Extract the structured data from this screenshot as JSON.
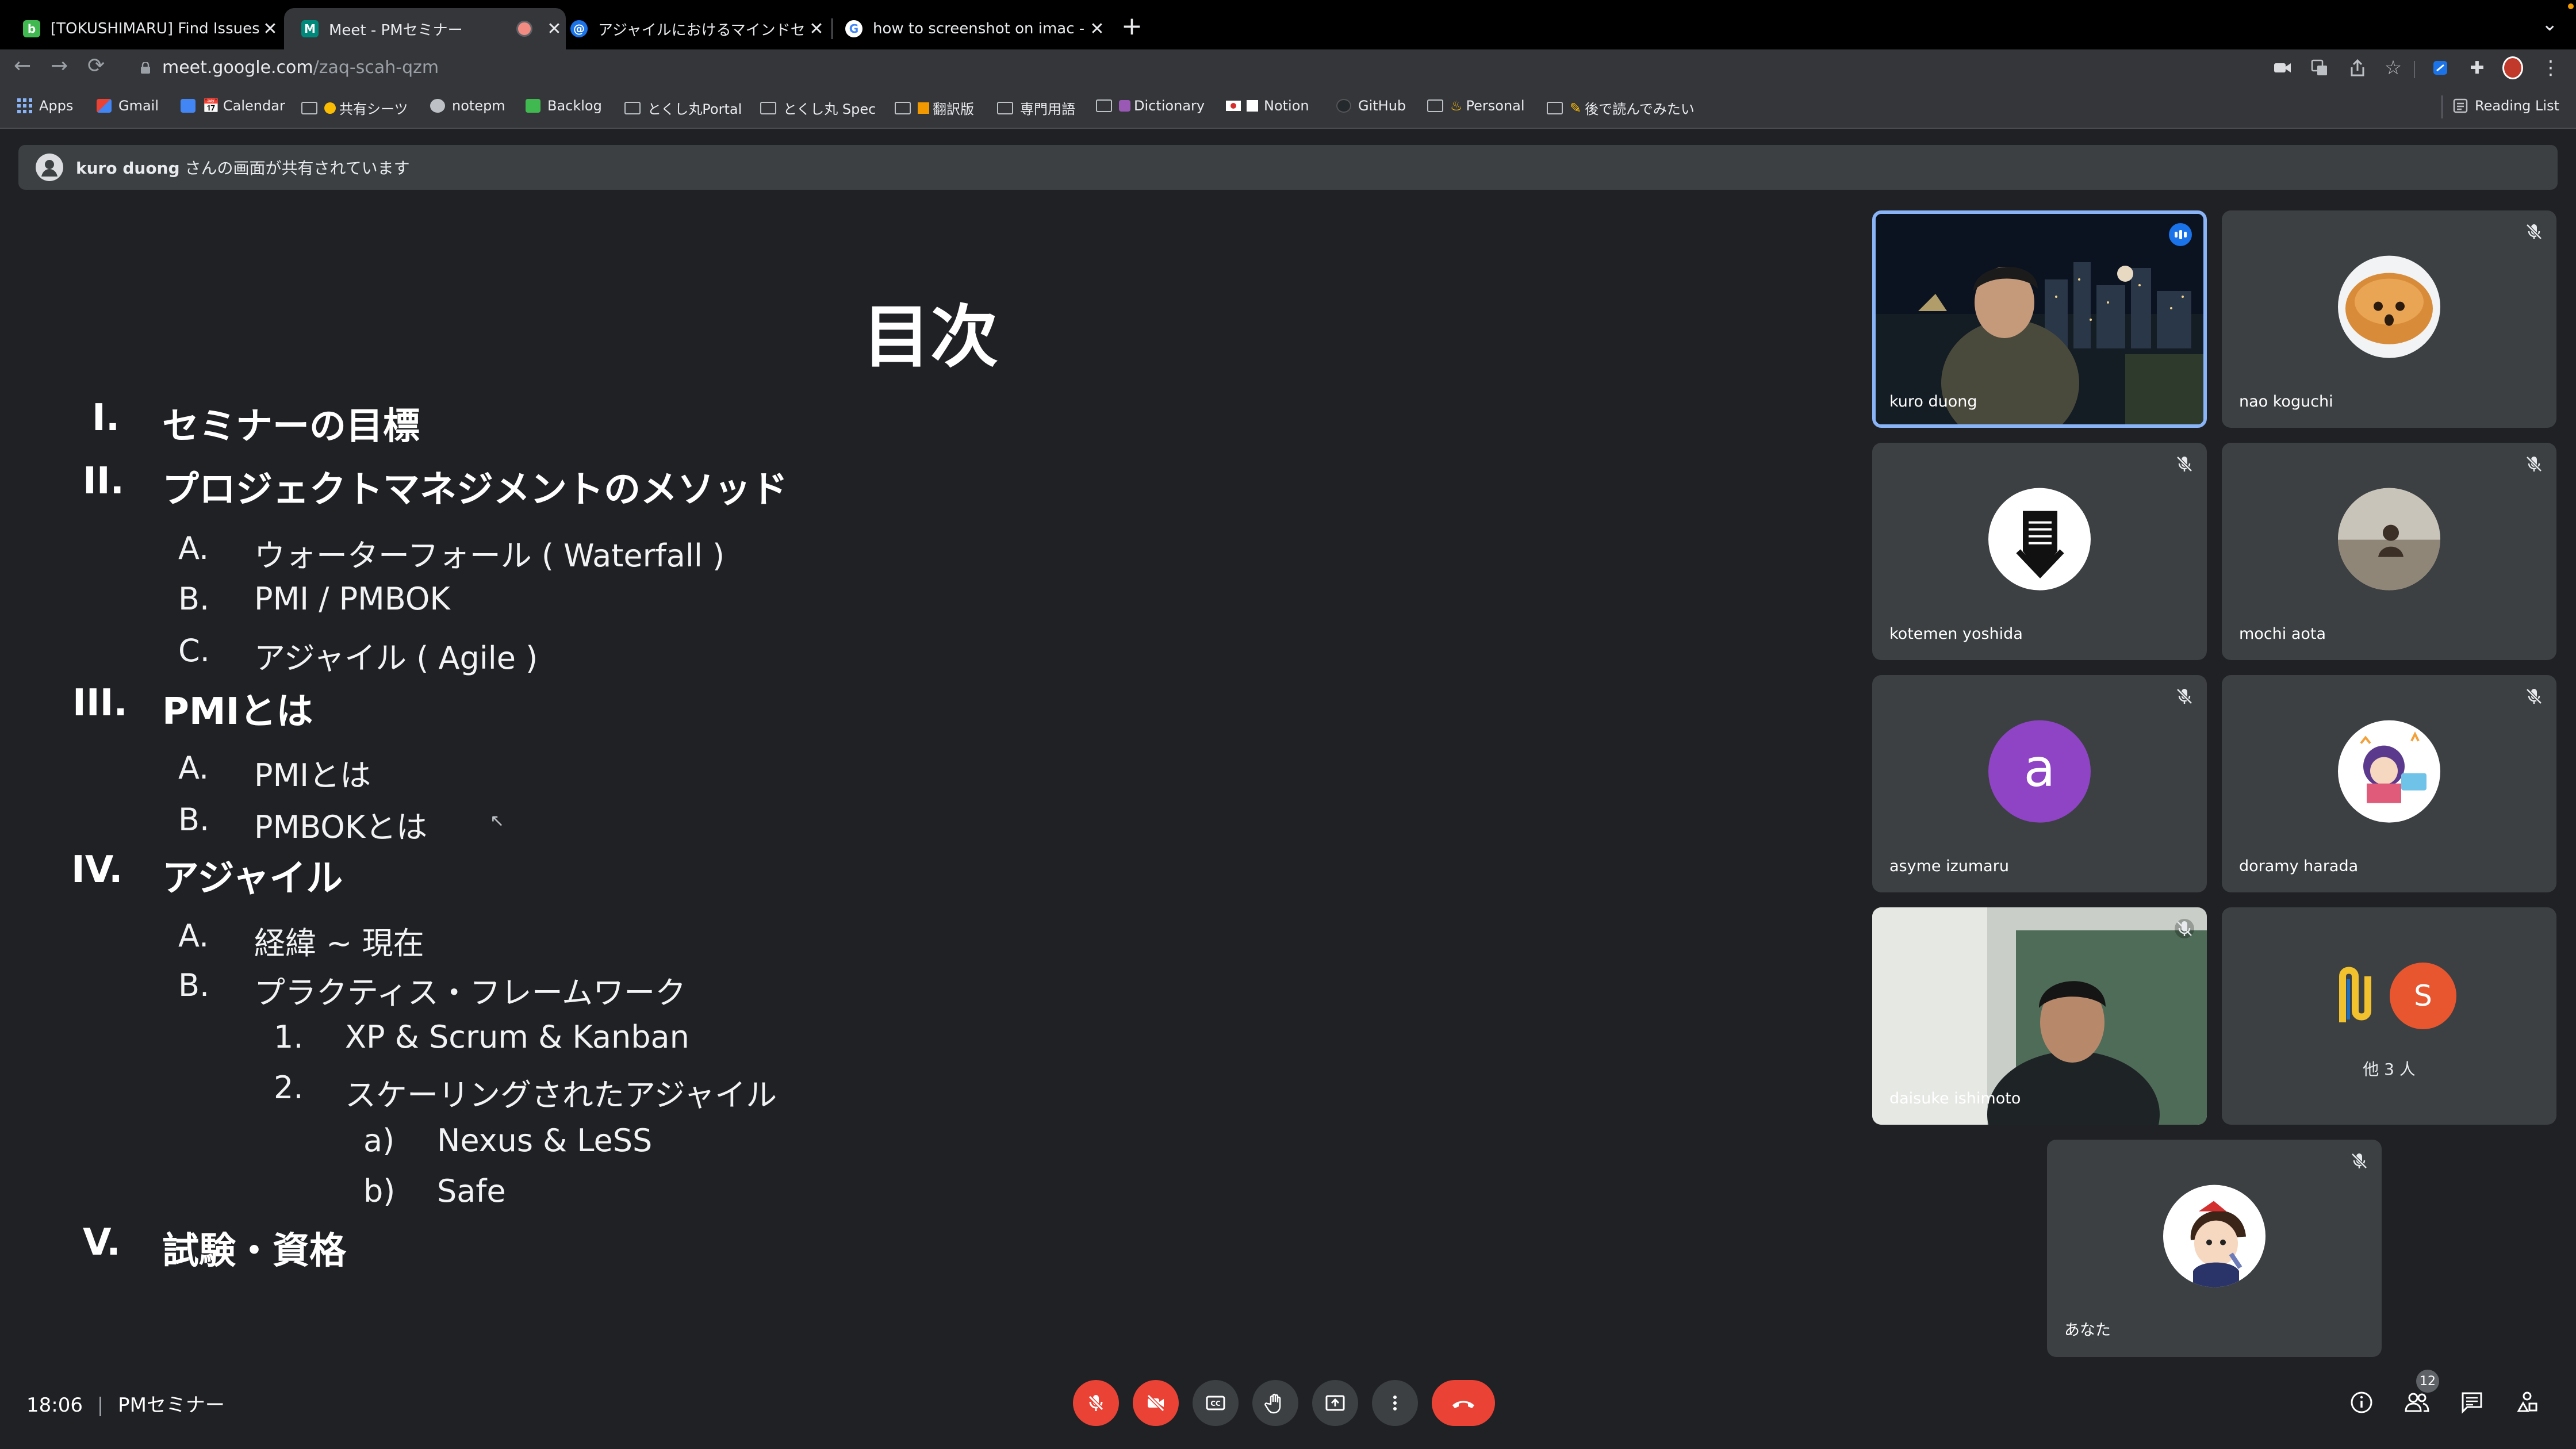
{
  "tabs": [
    {
      "title": "[TOKUSHIMARU] Find Issues |",
      "favicon_color": "#3fb950",
      "favicon_letter": "b"
    },
    {
      "title": "Meet - PMセミナー",
      "favicon_color": "#00897b",
      "favicon_letter": "M",
      "active": true
    },
    {
      "title": "アジャイルにおけるマインドセッ",
      "favicon_color": "#1a73e8",
      "favicon_letter": "@"
    },
    {
      "title": "how to screenshot on imac - G",
      "favicon_color": "#ffffff",
      "favicon_letter": "G"
    }
  ],
  "address": {
    "host": "meet.google.com",
    "path": "/zaq-scah-qzm"
  },
  "bookmarks": [
    {
      "label": "Apps",
      "type": "apps"
    },
    {
      "label": "Gmail",
      "type": "gmail"
    },
    {
      "label": "Calendar",
      "type": "calendar"
    },
    {
      "label": "共有シーツ",
      "type": "folder",
      "emoji": "🟡"
    },
    {
      "label": "notepm",
      "type": "site"
    },
    {
      "label": "Backlog",
      "type": "backlog"
    },
    {
      "label": "とくし丸Portal",
      "type": "folder"
    },
    {
      "label": "とくし丸 Spec",
      "type": "folder"
    },
    {
      "label": "翻訳版",
      "type": "folder",
      "emoji": "🟧"
    },
    {
      "label": "専門用語",
      "type": "folder"
    },
    {
      "label": "Dictionary",
      "type": "folder"
    },
    {
      "label": "Notion",
      "type": "notion"
    },
    {
      "label": "GitHub",
      "type": "github"
    },
    {
      "label": "Personal",
      "type": "folder"
    },
    {
      "label": "後で読んでみたい",
      "type": "folder"
    }
  ],
  "reading_list": "Reading List",
  "banner": {
    "presenter": "kuro duong",
    "suffix": " さんの画面が共有されています"
  },
  "slide": {
    "title": "目次",
    "items": [
      {
        "marker": "I.",
        "text": "セミナーの目標",
        "level": 0
      },
      {
        "marker": "II.",
        "text": "プロジェクトマネジメントのメソッド",
        "level": 0
      },
      {
        "marker": "A.",
        "text": "ウォーターフォール ( Waterfall )",
        "level": 1
      },
      {
        "marker": "B.",
        "text": "PMI / PMBOK",
        "level": 1
      },
      {
        "marker": "C.",
        "text": "アジャイル ( Agile )",
        "level": 1
      },
      {
        "marker": "III.",
        "text": "PMIとは",
        "level": 0
      },
      {
        "marker": "A.",
        "text": "PMIとは",
        "level": 1
      },
      {
        "marker": "B.",
        "text": "PMBOKとは",
        "level": 1
      },
      {
        "marker": "IV.",
        "text": "アジャイル",
        "level": 0
      },
      {
        "marker": "A.",
        "text": "経緯 ~ 現在",
        "level": 1
      },
      {
        "marker": "B.",
        "text": "プラクティス・フレームワーク",
        "level": 1
      },
      {
        "marker": "1.",
        "text": "XP & Scrum & Kanban",
        "level": 2
      },
      {
        "marker": "2.",
        "text": "スケーリングされたアジャイル",
        "level": 2
      },
      {
        "marker": "a)",
        "text": "Nexus & LeSS",
        "level": 3
      },
      {
        "marker": "b)",
        "text": "Safe",
        "level": 3
      },
      {
        "marker": "V.",
        "text": "試験・資格",
        "level": 0
      }
    ]
  },
  "participants": [
    {
      "name": "kuro duong",
      "kind": "video-night",
      "speaking": true
    },
    {
      "name": "nao koguchi",
      "kind": "avatar-bread",
      "muted": true
    },
    {
      "name": "kotemen yoshida",
      "kind": "avatar-kendo",
      "muted": true
    },
    {
      "name": "mochi aota",
      "kind": "avatar-photo",
      "muted": true
    },
    {
      "name": "asyme izumaru",
      "kind": "letter",
      "letter": "a",
      "color": "#8e44c4",
      "muted": true
    },
    {
      "name": "doramy harada",
      "kind": "avatar-cartoon",
      "muted": true
    },
    {
      "name": "daisuke ishimoto",
      "kind": "video-room",
      "muted": true
    },
    {
      "name": "他 3 人",
      "kind": "others",
      "letter": "S",
      "color": "#e8562f"
    },
    {
      "name": "あなた",
      "kind": "avatar-self",
      "muted": true
    }
  ],
  "footer": {
    "time": "18:06",
    "separator": "|",
    "meeting": "PMセミナー",
    "people_count": "12"
  },
  "colors": {
    "end_call": "#ea4335",
    "active_border": "#8ab4f8",
    "tile_bg": "#3c4043"
  }
}
